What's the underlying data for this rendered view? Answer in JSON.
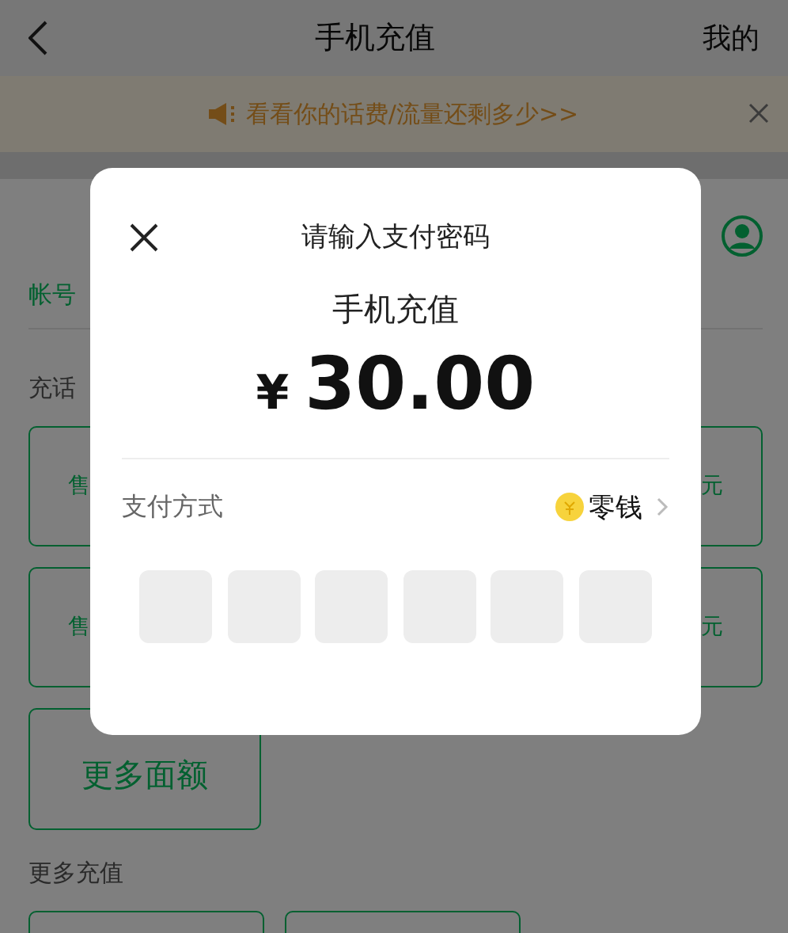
{
  "header": {
    "title": "手机充值",
    "right_link": "我的"
  },
  "banner": {
    "text": "看看你的话费/流量还剩多少>>"
  },
  "account": {
    "link": "帐号"
  },
  "section_title": "充话",
  "cards": [
    {
      "text": "售"
    },
    {
      "text": "元"
    },
    {
      "text": "售"
    },
    {
      "text": "元"
    }
  ],
  "more_button": "更多面额",
  "more_title": "更多充值",
  "dialog": {
    "title": "请输入支付密码",
    "item": "手机充值",
    "currency": "¥",
    "amount": "30.00",
    "method_label": "支付方式",
    "method_value": "零钱",
    "pin_boxes": [
      {
        "filled": false
      },
      {
        "filled": false
      },
      {
        "filled": false
      },
      {
        "filled": false
      },
      {
        "filled": false
      },
      {
        "filled": false
      }
    ]
  }
}
